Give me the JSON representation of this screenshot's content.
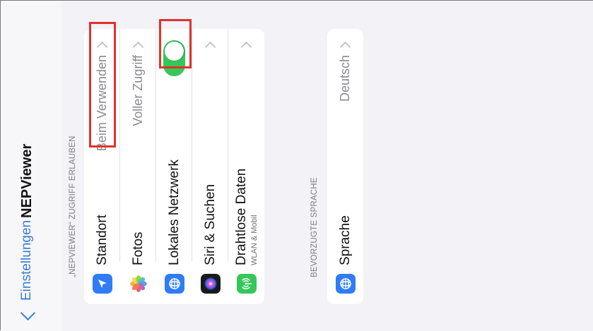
{
  "nav": {
    "back_label": "Einstellungen",
    "title": "NEPViewer"
  },
  "permissions": {
    "header": "„NEPVIEWER“ ZUGRIFF ERLAUBEN",
    "items": [
      {
        "label": "Standort",
        "value": "Beim Verwenden",
        "icon": "location-arrow-icon",
        "icon_color": "#2f7cf6"
      },
      {
        "label": "Fotos",
        "value": "Voller Zugriff",
        "icon": "photos-icon",
        "icon_color": "#ffffff"
      },
      {
        "label": "Lokales Netzwerk",
        "toggle_on": true,
        "icon": "globe-icon",
        "icon_color": "#2f7cf6"
      },
      {
        "label": "Siri & Suchen",
        "icon": "siri-icon",
        "icon_color": "#1a1a1a"
      },
      {
        "label": "Drahtlose Daten",
        "sublabel": "WLAN & Mobil",
        "icon": "antenna-icon",
        "icon_color": "#34c759"
      }
    ]
  },
  "language": {
    "header": "BEVORZUGTE SPRACHE",
    "items": [
      {
        "label": "Sprache",
        "value": "Deutsch",
        "icon": "globe-icon",
        "icon_color": "#2f7cf6"
      }
    ]
  },
  "colors": {
    "accent": "#3a7bd5",
    "toggle_on": "#35c759",
    "highlight": "#e0322b",
    "background": "#f2f2f7"
  }
}
